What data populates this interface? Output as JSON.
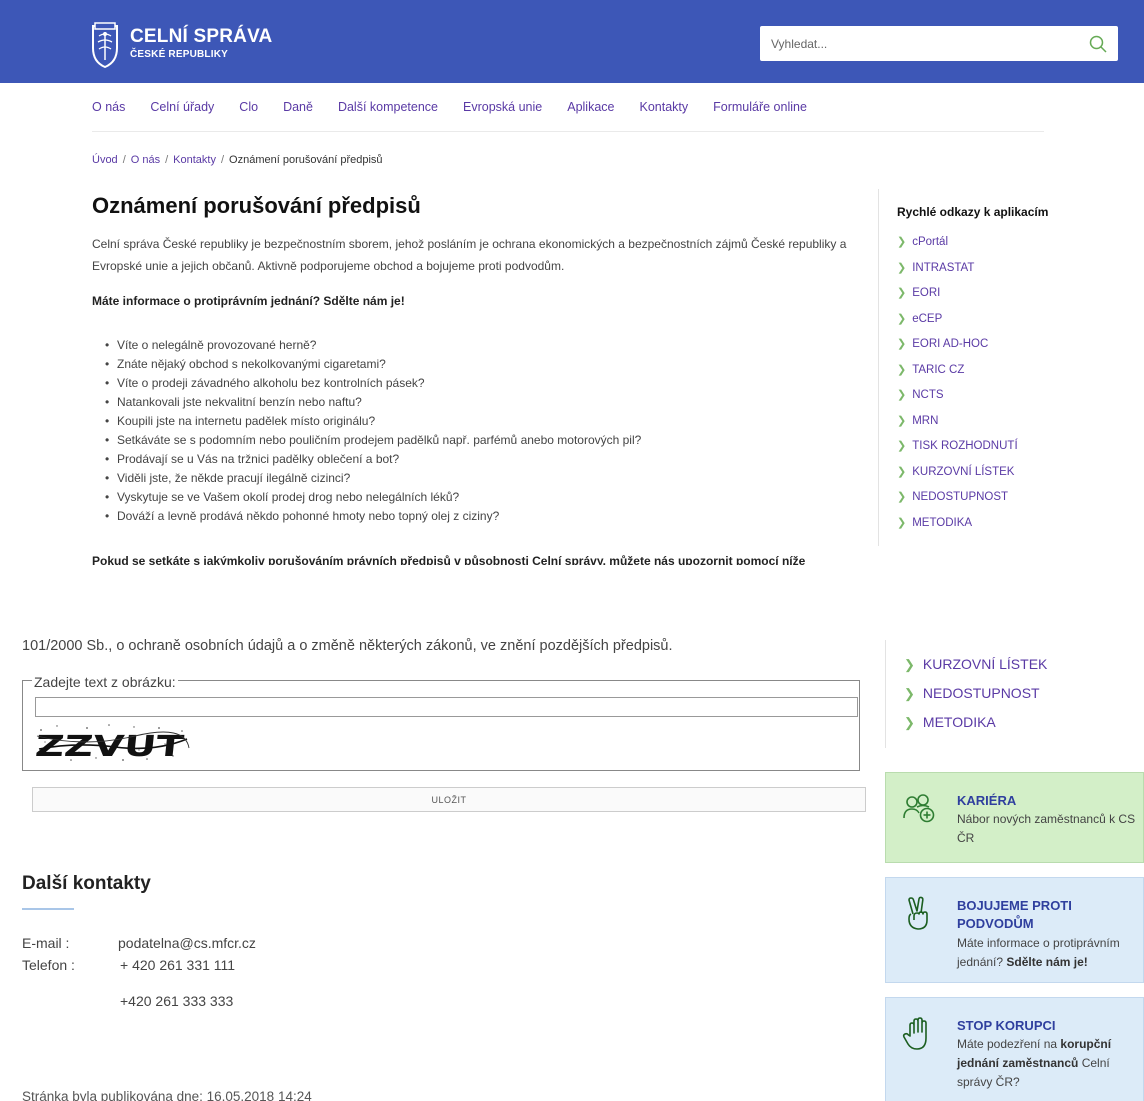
{
  "header": {
    "logo_title": "CELNÍ SPRÁVA",
    "logo_subtitle": "ČESKÉ REPUBLIKY",
    "search_placeholder": "Vyhledat..."
  },
  "nav": {
    "items": [
      "O nás",
      "Celní úřady",
      "Clo",
      "Daně",
      "Další kompetence",
      "Evropská unie",
      "Aplikace",
      "Kontakty",
      "Formuláře online"
    ]
  },
  "breadcrumb": {
    "items": [
      "Úvod",
      "O nás",
      "Kontakty"
    ],
    "current": "Oznámení porušování předpisů"
  },
  "article": {
    "title": "Oznámení porušování předpisů",
    "intro": "Celní správa České republiky je bezpečnostním sborem, jehož posláním je ochrana ekonomických a bezpečnostních zájmů České republiky a Evropské unie a jejich občanů. Aktivně podporujeme obchod a bojujeme proti podvodům.",
    "question": "Máte informace o protiprávním jednání? Sdělte nám je!",
    "bullets": [
      "Víte o nelegálně provozované herně?",
      "Znáte nějaký obchod s nekolkovanými cigaretami?",
      "Víte o prodeji závadného alkoholu bez kontrolních pásek?",
      "Natankovali jste nekvalitní benzín nebo naftu?",
      "Koupili jste na internetu padělek místo originálu?",
      "Setkáváte se s podomním nebo pouličním prodejem padělků např. parfémů anebo motorových pil?",
      "Prodávají se u Vás na tržnici padělky oblečení a bot?",
      "Viděli jste, že někde pracují ilegálně cizinci?",
      "Vyskytuje se ve Vašem okolí prodej drog nebo nelegálních léků?",
      "Dováží a levně prodává někdo pohonné hmoty nebo topný olej z ciziny?"
    ],
    "cut_sentence": "Pokud se setkáte s jakýmkoliv porušováním právních předpisů v působnosti Celní správy, můžete nás upozornit pomocí níže"
  },
  "sidebar": {
    "title": "Rychlé odkazy k aplikacím",
    "links": [
      "cPortál",
      "INTRASTAT",
      "EORI",
      "eCEP",
      "EORI AD-HOC",
      "TARIC CZ",
      "NCTS",
      "MRN",
      "TISK ROZHODNUTÍ",
      "KURZOVNÍ LÍSTEK",
      "NEDOSTUPNOST",
      "METODIKA"
    ]
  },
  "lower": {
    "law_text": "101/2000 Sb., o ochraně osobních údajů a o změně některých zákonů, ve znění pozdějších předpisů.",
    "captcha_legend": "Zadejte text z obrázku:",
    "captcha_text": "ZZVUT",
    "save_label": "ULOŽIT",
    "contacts_title": "Další kontakty",
    "email_label": "E-mail :",
    "email_value": "podatelna@cs.mfcr.cz",
    "phone_label": "Telefon :",
    "phone_value_1": "+ 420 261 331 111",
    "phone_value_2": "+420 261 333 333",
    "published": "Stránka byla publikována dne: 16.05.2018 14:24",
    "side_links": [
      "KURZOVNÍ LÍSTEK",
      "NEDOSTUPNOST",
      "METODIKA"
    ]
  },
  "cards": {
    "career": {
      "title": "KARIÉRA",
      "text": "Nábor nových zaměstnanců k CS ČR"
    },
    "fraud": {
      "title": "BOJUJEME PROTI PODVODŮM",
      "text_1": "Máte informace o protiprávním jednání?",
      "text_bold": "Sdělte nám je!"
    },
    "corruption": {
      "title": "STOP KORUPCI",
      "text_1": "Máte podezření na",
      "text_bold": "korupční jednání zaměstnanců",
      "text_2": "Celní správy ČR?"
    }
  },
  "colors": {
    "header_bg": "#3d57b7",
    "link": "#5a3aa5",
    "chevron": "#7cb86a",
    "card_green": "#d3efc8",
    "card_blue": "#dcebf8"
  }
}
